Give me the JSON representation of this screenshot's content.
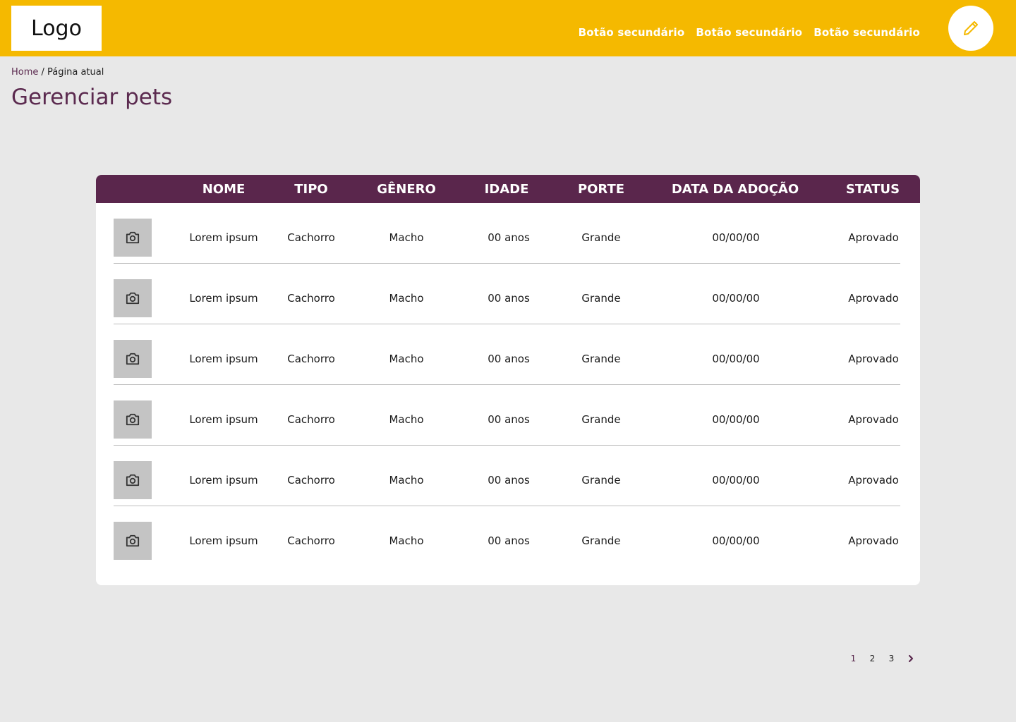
{
  "header": {
    "logo": "Logo",
    "nav": [
      "Botão secundário",
      "Botão secundário",
      "Botão secundário"
    ],
    "edit_icon": "pencil-icon",
    "accent_color": "#f5b900"
  },
  "breadcrumb": {
    "home": "Home",
    "separator": " / ",
    "current": "Página atual"
  },
  "page": {
    "title": "Gerenciar pets",
    "title_color": "#5b2a4f"
  },
  "table": {
    "header_color": "#5a264c",
    "columns": [
      "NOME",
      "TIPO",
      "GÊNERO",
      "IDADE",
      "PORTE",
      "DATA DA ADOÇÃO",
      "STATUS"
    ],
    "photo_icon": "camera-icon",
    "rows": [
      {
        "nome": "Lorem ipsum",
        "tipo": "Cachorro",
        "genero": "Macho",
        "idade": "00 anos",
        "porte": "Grande",
        "data": "00/00/00",
        "status": "Aprovado"
      },
      {
        "nome": "Lorem ipsum",
        "tipo": "Cachorro",
        "genero": "Macho",
        "idade": "00 anos",
        "porte": "Grande",
        "data": "00/00/00",
        "status": "Aprovado"
      },
      {
        "nome": "Lorem ipsum",
        "tipo": "Cachorro",
        "genero": "Macho",
        "idade": "00 anos",
        "porte": "Grande",
        "data": "00/00/00",
        "status": "Aprovado"
      },
      {
        "nome": "Lorem ipsum",
        "tipo": "Cachorro",
        "genero": "Macho",
        "idade": "00 anos",
        "porte": "Grande",
        "data": "00/00/00",
        "status": "Aprovado"
      },
      {
        "nome": "Lorem ipsum",
        "tipo": "Cachorro",
        "genero": "Macho",
        "idade": "00 anos",
        "porte": "Grande",
        "data": "00/00/00",
        "status": "Aprovado"
      },
      {
        "nome": "Lorem ipsum",
        "tipo": "Cachorro",
        "genero": "Macho",
        "idade": "00 anos",
        "porte": "Grande",
        "data": "00/00/00",
        "status": "Aprovado"
      }
    ]
  },
  "pagination": {
    "pages": [
      "1",
      "2",
      "3"
    ],
    "current": "1",
    "next_icon": "chevron-right-icon"
  }
}
